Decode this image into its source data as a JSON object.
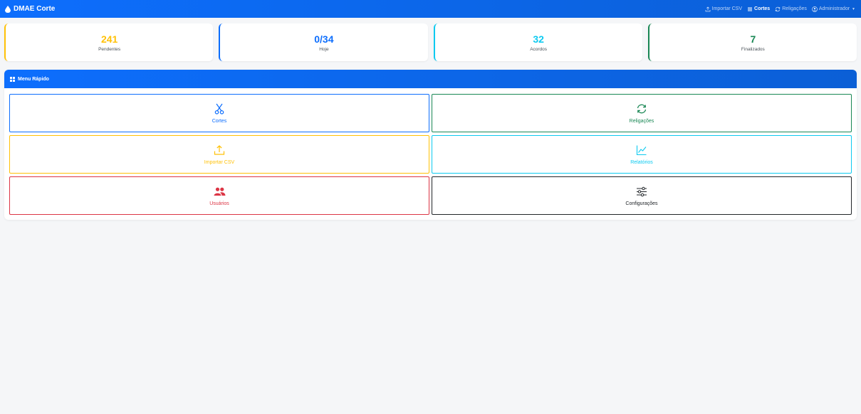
{
  "navbar": {
    "brand": "DMAE Corte",
    "links": [
      {
        "label": "Importar CSV",
        "icon": "upload-icon"
      },
      {
        "label": "Cortes",
        "icon": "list-icon",
        "active": true
      },
      {
        "label": "Religações",
        "icon": "refresh-icon"
      },
      {
        "label": "Administrador",
        "icon": "user-circle-icon"
      }
    ]
  },
  "stats": [
    {
      "value": "241",
      "label": "Pendentes",
      "color": "#ffc107"
    },
    {
      "value": "0/34",
      "label": "Hoje",
      "color": "#0d6efd"
    },
    {
      "value": "32",
      "label": "Acordos",
      "color": "#0dcaf0"
    },
    {
      "value": "7",
      "label": "Finalizados",
      "color": "#198754"
    }
  ],
  "quick_menu": {
    "title": "Menu Rápido",
    "items": [
      {
        "label": "Cortes",
        "icon": "scissors-icon",
        "color": "#0d6efd"
      },
      {
        "label": "Religações",
        "icon": "refresh-icon",
        "color": "#198754"
      },
      {
        "label": "Importar CSV",
        "icon": "upload-icon",
        "color": "#ffc107"
      },
      {
        "label": "Relatórios",
        "icon": "line-chart-icon",
        "color": "#0dcaf0"
      },
      {
        "label": "Usuários",
        "icon": "users-icon",
        "color": "#dc3545"
      },
      {
        "label": "Configurações",
        "icon": "sliders-icon",
        "color": "#212529"
      }
    ]
  }
}
